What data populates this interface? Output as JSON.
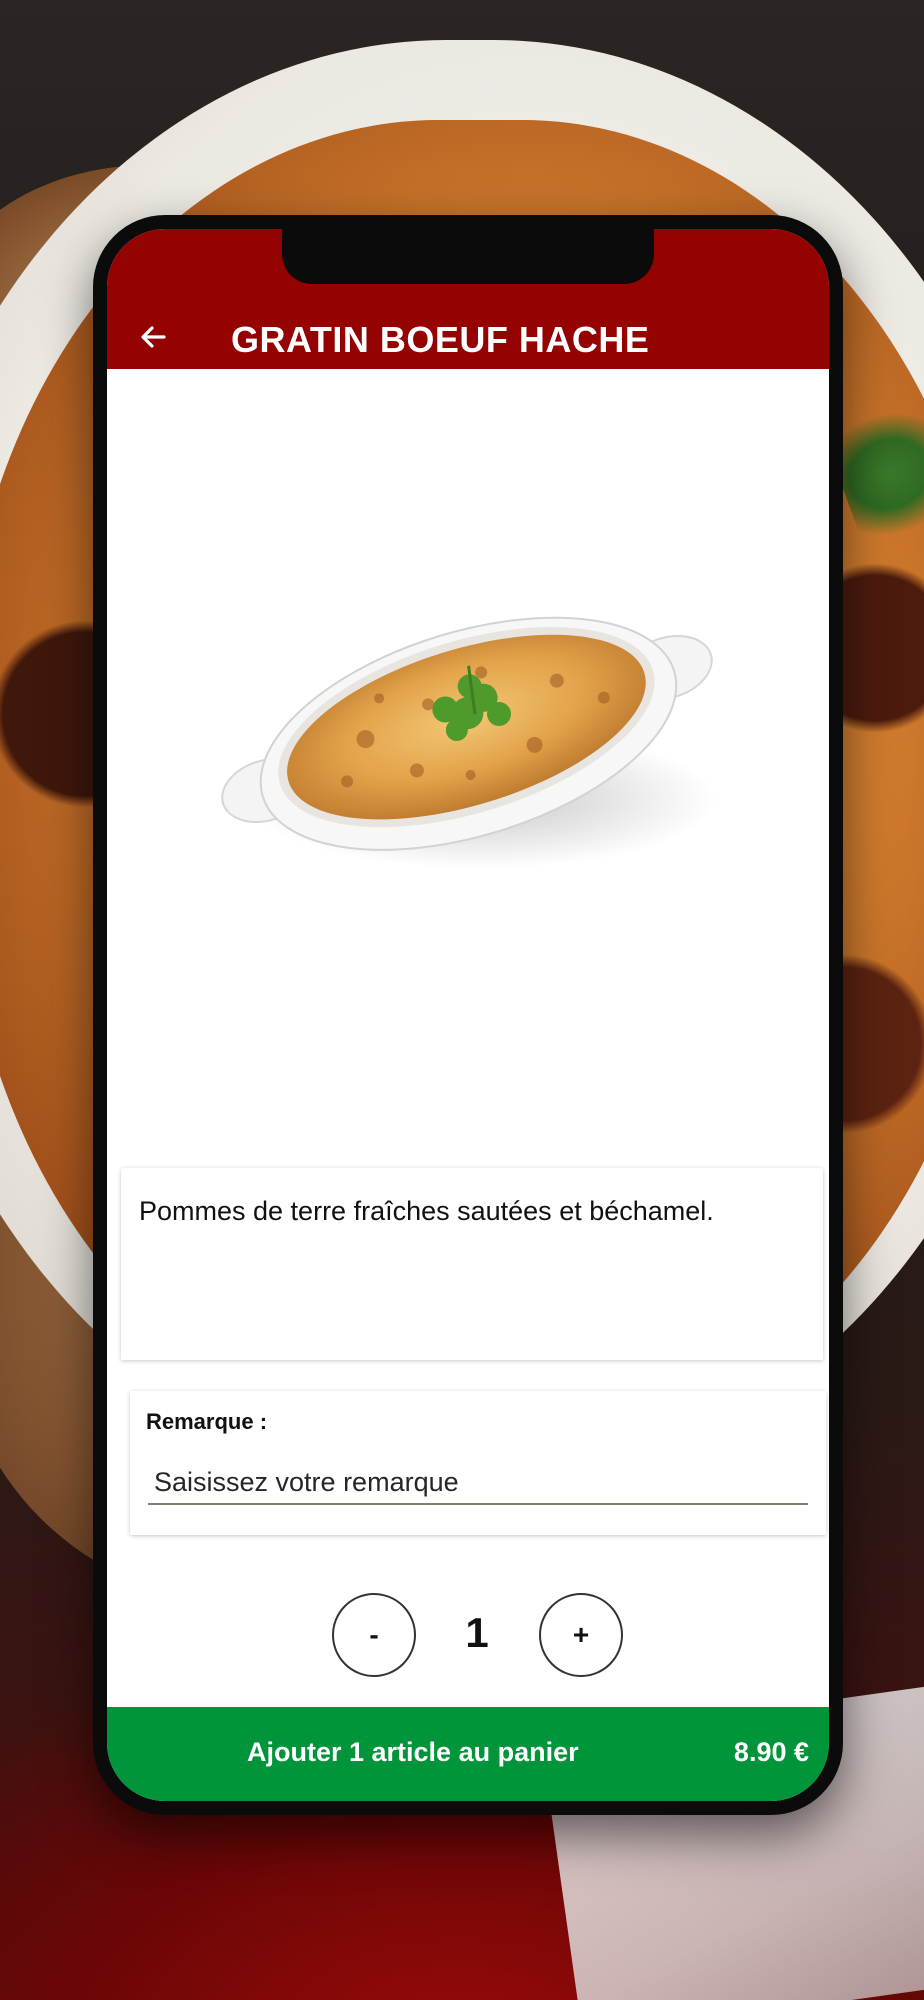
{
  "header": {
    "back_icon": "arrow-left-icon",
    "title": "GRATIN BOEUF HACHE",
    "background_color": "#940202"
  },
  "product": {
    "image_icon": "gratin-dish-image",
    "description": "Pommes de terre fraîches sautées et béchamel."
  },
  "remark": {
    "label": "Remarque :",
    "placeholder": "Saisissez votre remarque",
    "value": ""
  },
  "quantity": {
    "minus_label": "-",
    "value": "1",
    "plus_label": "+"
  },
  "cart": {
    "add_label": "Ajouter 1 article au panier",
    "price": "8.90 €",
    "button_color": "#00953a"
  }
}
